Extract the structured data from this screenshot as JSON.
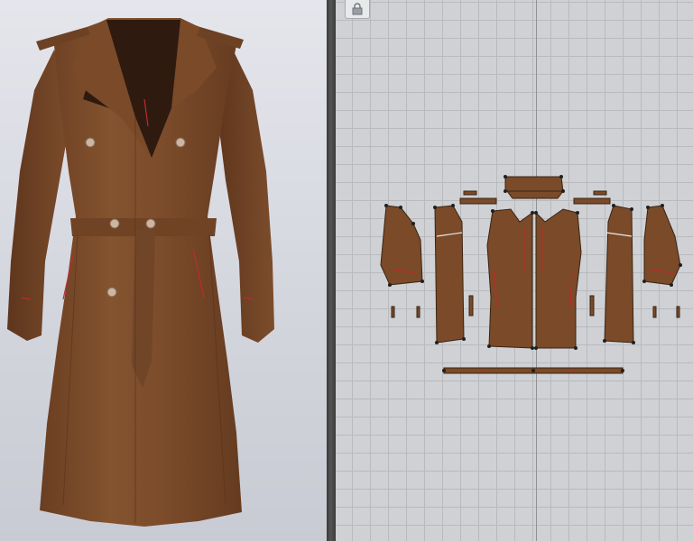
{
  "app": {
    "title": ""
  },
  "viewport3d": {
    "background": "#d8dae1",
    "garment": "trench-coat",
    "fabric_color": "#7a4a29",
    "lining_color": "#2f1a0f",
    "stitch_color": "#c02a2a"
  },
  "viewport2d": {
    "grid": true,
    "background": "#cfd1d4",
    "grid_color": "#b8babe",
    "toolbar": {
      "icon": "lock-icon"
    }
  },
  "pattern_pieces": [
    {
      "name": "sleeve-left"
    },
    {
      "name": "side-back-left"
    },
    {
      "name": "front-left"
    },
    {
      "name": "front-right"
    },
    {
      "name": "side-back-right"
    },
    {
      "name": "sleeve-right"
    },
    {
      "name": "collar"
    },
    {
      "name": "epaulette-left"
    },
    {
      "name": "epaulette-right"
    },
    {
      "name": "belt"
    }
  ]
}
